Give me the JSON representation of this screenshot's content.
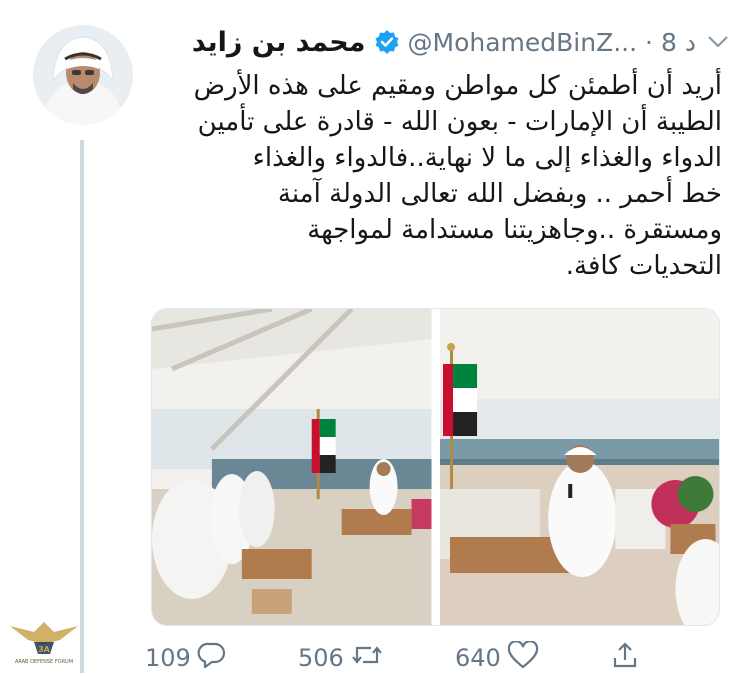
{
  "tweet": {
    "display_name": "محمد بن زايد",
    "handle": "@MohamedBinZ...",
    "separator": "·",
    "time": "8 د",
    "text_lines": [
      "أريد أن أطمئن كل مواطن ومقيم على هذه الأرض",
      "الطيبة أن الإمارات - بعون الله - قادرة على تأمين",
      "الدواء والغذاء إلى ما لا نهاية..فالدواء والغذاء",
      "خط أحمر .. وبفضل الله تعالى الدولة آمنة",
      "ومستقرة ..وجاهزيتنا مستدامة لمواجهة",
      "التحديات كافة."
    ]
  },
  "actions": {
    "replies": "109",
    "retweets": "506",
    "likes": "640"
  },
  "watermark": {
    "line1": "ARAB DEFENSE FORUM"
  },
  "colors": {
    "verified": "#1da1f2",
    "muted": "#657786",
    "text": "#14171a"
  },
  "icons": [
    "chevron-down-icon",
    "verified-badge-icon",
    "reply-icon",
    "retweet-icon",
    "like-icon",
    "share-icon"
  ]
}
